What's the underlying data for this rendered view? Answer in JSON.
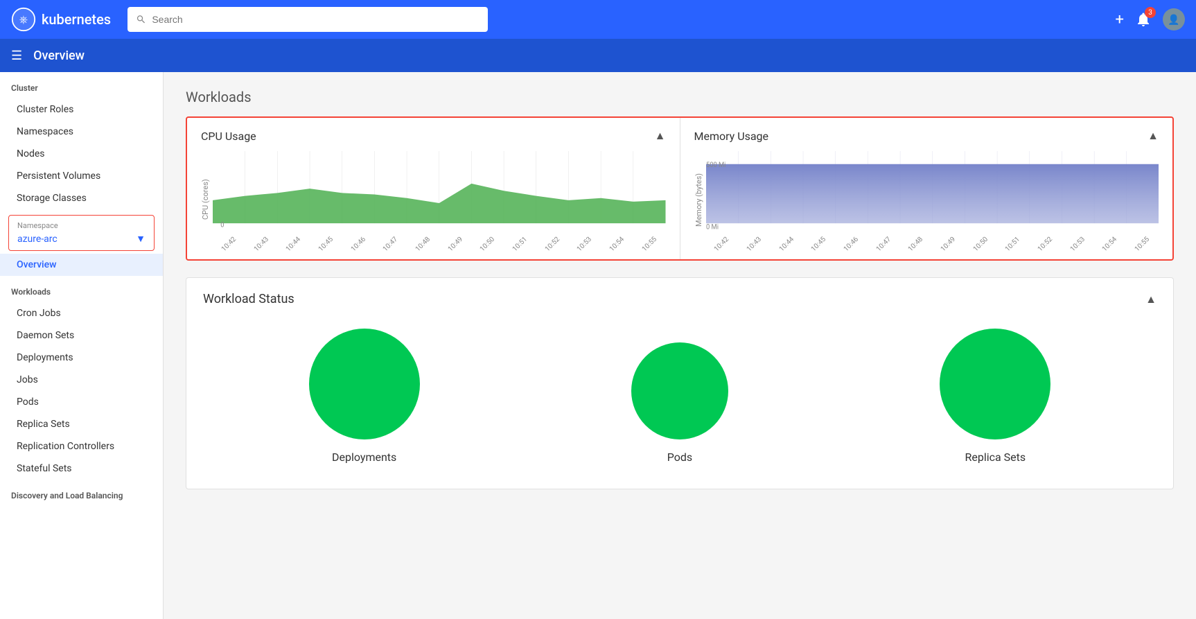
{
  "topbar": {
    "logo_text": "kubernetes",
    "search_placeholder": "Search",
    "notification_count": "3",
    "add_label": "+",
    "add_icon": "plus-icon",
    "notification_icon": "bell-icon",
    "user_icon": "user-icon"
  },
  "subheader": {
    "hamburger_icon": "menu-icon",
    "page_title": "Overview"
  },
  "sidebar": {
    "cluster_label": "Cluster",
    "cluster_items": [
      {
        "label": "Cluster Roles",
        "id": "cluster-roles"
      },
      {
        "label": "Namespaces",
        "id": "namespaces"
      },
      {
        "label": "Nodes",
        "id": "nodes"
      },
      {
        "label": "Persistent Volumes",
        "id": "persistent-volumes"
      },
      {
        "label": "Storage Classes",
        "id": "storage-classes"
      }
    ],
    "namespace_label": "Namespace",
    "namespace_value": "azure-arc",
    "overview_label": "Overview",
    "workloads_label": "Workloads",
    "workloads_items": [
      {
        "label": "Cron Jobs",
        "id": "cron-jobs"
      },
      {
        "label": "Daemon Sets",
        "id": "daemon-sets"
      },
      {
        "label": "Deployments",
        "id": "deployments"
      },
      {
        "label": "Jobs",
        "id": "jobs"
      },
      {
        "label": "Pods",
        "id": "pods"
      },
      {
        "label": "Replica Sets",
        "id": "replica-sets"
      },
      {
        "label": "Replication Controllers",
        "id": "replication-controllers"
      },
      {
        "label": "Stateful Sets",
        "id": "stateful-sets"
      }
    ],
    "discovery_label": "Discovery and Load Balancing"
  },
  "main": {
    "section_title": "Workloads",
    "cpu_chart": {
      "title": "CPU Usage",
      "y_label": "CPU (cores)",
      "y_max": "",
      "y_min": "0",
      "x_labels": [
        "10:42",
        "10:43",
        "10:44",
        "10:45",
        "10:46",
        "10:47",
        "10:48",
        "10:49",
        "10:50",
        "10:51",
        "10:52",
        "10:53",
        "10:54",
        "10:55"
      ]
    },
    "memory_chart": {
      "title": "Memory Usage",
      "y_label": "Memory (bytes)",
      "y_max": "500 Mi",
      "y_min": "0 Mi",
      "x_labels": [
        "10:42",
        "10:43",
        "10:44",
        "10:45",
        "10:46",
        "10:47",
        "10:48",
        "10:49",
        "10:50",
        "10:51",
        "10:52",
        "10:53",
        "10:54",
        "10:55"
      ]
    },
    "workload_status_title": "Workload Status",
    "status_items": [
      {
        "label": "Deployments",
        "size": "large"
      },
      {
        "label": "Pods",
        "size": "medium"
      },
      {
        "label": "Replica Sets",
        "size": "large"
      }
    ]
  }
}
